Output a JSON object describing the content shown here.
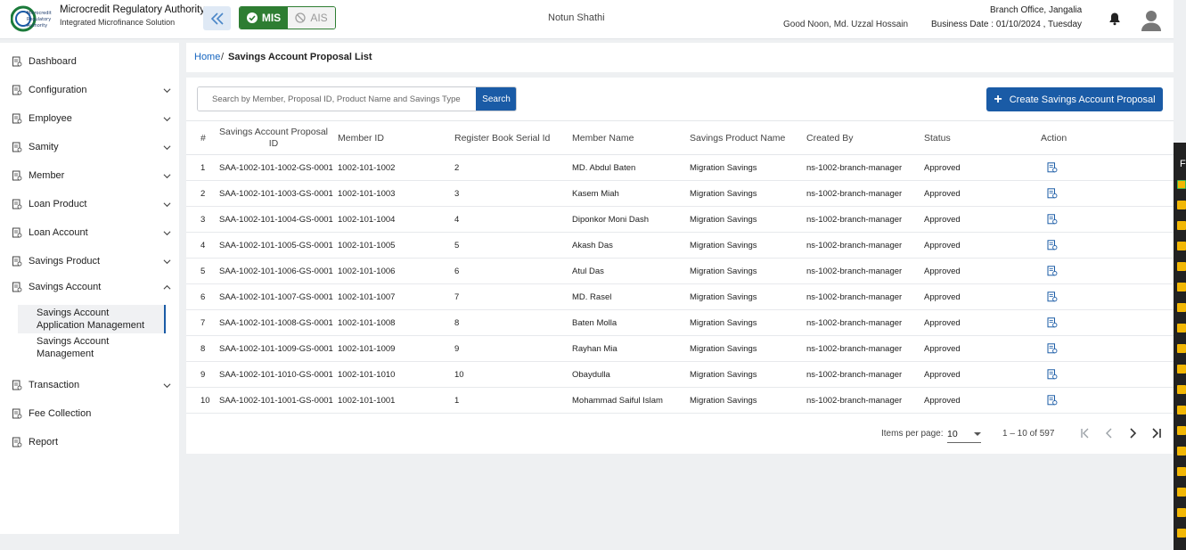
{
  "header": {
    "brand_title": "Microcredit Regulatory Authority",
    "brand_subtitle": "Integrated Microfinance Solution",
    "logo_text": "Microcredit Regulatory Authority",
    "mode_mis": "MIS",
    "mode_ais": "AIS",
    "org_name": "Notun Shathi",
    "greeting": "Good Noon, Md. Uzzal Hossain",
    "branch": "Branch Office, Jangalia",
    "business_date": "Business Date : 01/10/2024 , Tuesday"
  },
  "sidebar": {
    "items": [
      {
        "label": "Dashboard",
        "icon": "dashboard-icon",
        "expandable": false
      },
      {
        "label": "Configuration",
        "icon": "config-icon",
        "expandable": true
      },
      {
        "label": "Employee",
        "icon": "employee-icon",
        "expandable": true
      },
      {
        "label": "Samity",
        "icon": "samity-icon",
        "expandable": true
      },
      {
        "label": "Member",
        "icon": "member-icon",
        "expandable": true
      },
      {
        "label": "Loan Product",
        "icon": "document-icon",
        "expandable": true
      },
      {
        "label": "Loan Account",
        "icon": "people-icon",
        "expandable": true
      },
      {
        "label": "Savings Product",
        "icon": "document-icon",
        "expandable": true
      },
      {
        "label": "Savings Account",
        "icon": "document-icon",
        "expandable": true,
        "expanded": true
      },
      {
        "label": "Transaction",
        "icon": "document-icon",
        "expandable": true
      },
      {
        "label": "Fee Collection",
        "icon": "fee-icon",
        "expandable": false
      },
      {
        "label": "Report",
        "icon": "document-icon",
        "expandable": false
      }
    ],
    "savings_account_sub": [
      {
        "label_line1": "Savings Account",
        "label_line2": "Application Management",
        "active": true
      },
      {
        "label_line1": "Savings Account",
        "label_line2": "Management",
        "active": false
      }
    ]
  },
  "breadcrumb": {
    "home": "Home",
    "separator": "/",
    "current": "Savings Account Proposal List"
  },
  "toolbar": {
    "search_placeholder": "Search by Member, Proposal ID, Product Name and Savings Type",
    "search_label": "Search",
    "create_label": "Create Savings Account Proposal"
  },
  "table": {
    "headers": {
      "num": "#",
      "proposal_id_1": "Savings Account Proposal",
      "proposal_id_2": "ID",
      "member_id": "Member ID",
      "register_serial": "Register Book Serial Id",
      "member_name": "Member Name",
      "product_name": "Savings Product Name",
      "created_by": "Created By",
      "status": "Status",
      "action": "Action"
    },
    "rows": [
      {
        "num": "1",
        "proposal_id": "SAA-1002-101-1002-GS-0001",
        "member_id": "1002-101-1002",
        "serial": "2",
        "name": "MD. Abdul Baten",
        "product": "Migration Savings",
        "created_by": "ns-1002-branch-manager",
        "status": "Approved"
      },
      {
        "num": "2",
        "proposal_id": "SAA-1002-101-1003-GS-0001",
        "member_id": "1002-101-1003",
        "serial": "3",
        "name": "Kasem Miah",
        "product": "Migration Savings",
        "created_by": "ns-1002-branch-manager",
        "status": "Approved"
      },
      {
        "num": "3",
        "proposal_id": "SAA-1002-101-1004-GS-0001",
        "member_id": "1002-101-1004",
        "serial": "4",
        "name": "Diponkor Moni Dash",
        "product": "Migration Savings",
        "created_by": "ns-1002-branch-manager",
        "status": "Approved"
      },
      {
        "num": "4",
        "proposal_id": "SAA-1002-101-1005-GS-0001",
        "member_id": "1002-101-1005",
        "serial": "5",
        "name": "Akash Das",
        "product": "Migration Savings",
        "created_by": "ns-1002-branch-manager",
        "status": "Approved"
      },
      {
        "num": "5",
        "proposal_id": "SAA-1002-101-1006-GS-0001",
        "member_id": "1002-101-1006",
        "serial": "6",
        "name": "Atul Das",
        "product": "Migration Savings",
        "created_by": "ns-1002-branch-manager",
        "status": "Approved"
      },
      {
        "num": "6",
        "proposal_id": "SAA-1002-101-1007-GS-0001",
        "member_id": "1002-101-1007",
        "serial": "7",
        "name": "MD. Rasel",
        "product": "Migration Savings",
        "created_by": "ns-1002-branch-manager",
        "status": "Approved"
      },
      {
        "num": "7",
        "proposal_id": "SAA-1002-101-1008-GS-0001",
        "member_id": "1002-101-1008",
        "serial": "8",
        "name": "Baten Molla",
        "product": "Migration Savings",
        "created_by": "ns-1002-branch-manager",
        "status": "Approved"
      },
      {
        "num": "8",
        "proposal_id": "SAA-1002-101-1009-GS-0001",
        "member_id": "1002-101-1009",
        "serial": "9",
        "name": "Rayhan Mia",
        "product": "Migration Savings",
        "created_by": "ns-1002-branch-manager",
        "status": "Approved"
      },
      {
        "num": "9",
        "proposal_id": "SAA-1002-101-1010-GS-0001",
        "member_id": "1002-101-1010",
        "serial": "10",
        "name": "Obaydulla",
        "product": "Migration Savings",
        "created_by": "ns-1002-branch-manager",
        "status": "Approved"
      },
      {
        "num": "10",
        "proposal_id": "SAA-1002-101-1001-GS-0001",
        "member_id": "1002-101-1001",
        "serial": "1",
        "name": "Mohammad Saiful Islam",
        "product": "Migration Savings",
        "created_by": "ns-1002-branch-manager",
        "status": "Approved"
      }
    ]
  },
  "pager": {
    "items_per_page_label": "Items per page:",
    "items_per_page_value": "10",
    "range": "1 – 10 of 597"
  },
  "right_strip_letter": "F",
  "colors": {
    "primary": "#1a5ba6",
    "mis_green": "#2e7d32",
    "link": "#1565c0"
  }
}
